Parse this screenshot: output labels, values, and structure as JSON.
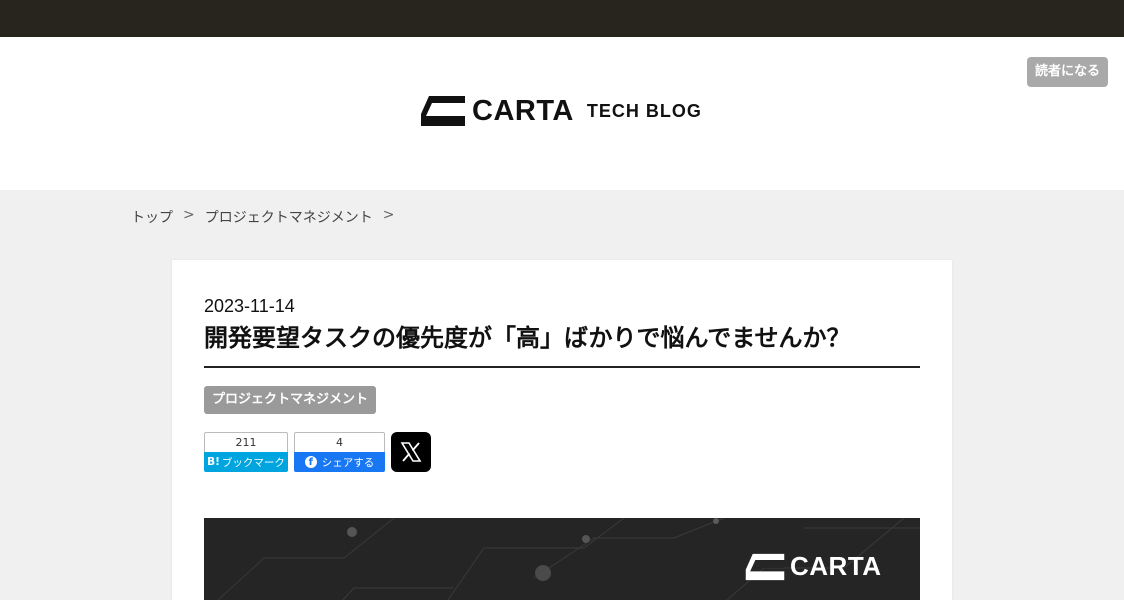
{
  "header": {
    "reader_button": "読者になる",
    "logo_text": "CARTA",
    "logo_subtitle": "TECH BLOG"
  },
  "breadcrumb": {
    "items": [
      "トップ",
      "プロジェクトマネジメント"
    ],
    "separator": ">"
  },
  "article": {
    "date": "2023-11-14",
    "title": "開発要望タスクの優先度が「高」ばかりで悩んでませんか？",
    "category": "プロジェクトマネジメント",
    "share": {
      "hatena": {
        "count": "211",
        "label": "ブックマーク",
        "mark": "B!"
      },
      "facebook": {
        "count": "4",
        "label": "シェアする",
        "icon": "f"
      },
      "x_icon": "x-logo-icon"
    },
    "hero_logo_text": "CARTA"
  },
  "colors": {
    "topbar": "#28251f",
    "hatena": "#00a4de",
    "facebook": "#1877f2",
    "tag": "#9a9a9a",
    "hero_bg": "#252525"
  }
}
